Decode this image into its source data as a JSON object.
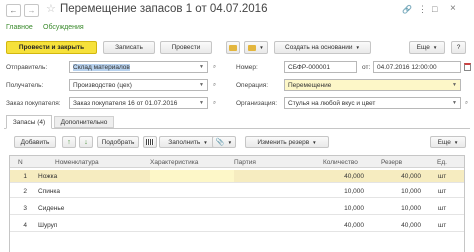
{
  "window": {
    "title": "Перемещение запасов 1 от 04.07.2016"
  },
  "tabs": {
    "main": "Главное",
    "discussions": "Обсуждения"
  },
  "toolbar": {
    "post_close": "Провести и закрыть",
    "save": "Записать",
    "post": "Провести",
    "create_based": "Создать на основании",
    "more": "Еще",
    "help": "?"
  },
  "form": {
    "sender_label": "Отправитель:",
    "sender_value": "Склад материалов",
    "receiver_label": "Получатель:",
    "receiver_value": "Производство (цех)",
    "buyer_order_label": "Заказ покупателя:",
    "buyer_order_value": "Заказ покупателя 16 от 01.07.2016",
    "number_label": "Номер:",
    "number_value": "СБФР-000001",
    "date_label": "от:",
    "date_value": "04.07.2016 12:00:00",
    "operation_label": "Операция:",
    "operation_value": "Перемещение",
    "org_label": "Организация:",
    "org_value": "Стулья на любой вкус и цвет"
  },
  "section_tabs": {
    "stocks": "Запасы (4)",
    "additional": "Дополнительно"
  },
  "table_toolbar": {
    "add": "Добавить",
    "pick": "Подобрать",
    "fill": "Заполнить",
    "change_reserve": "Изменить резерв",
    "more": "Еще"
  },
  "table": {
    "headers": {
      "n": "N",
      "item": "Номенклатура",
      "char": "Характеристика",
      "batch": "Партия",
      "qty": "Количество",
      "reserve": "Резерв",
      "unit": "Ед."
    },
    "rows": [
      {
        "n": "1",
        "item": "Ножка",
        "char": "",
        "batch": "",
        "qty": "40,000",
        "reserve": "40,000",
        "unit": "шт"
      },
      {
        "n": "2",
        "item": "Спинка",
        "char": "",
        "batch": "",
        "qty": "10,000",
        "reserve": "10,000",
        "unit": "шт"
      },
      {
        "n": "3",
        "item": "Сиденье",
        "char": "",
        "batch": "",
        "qty": "10,000",
        "reserve": "10,000",
        "unit": "шт"
      },
      {
        "n": "4",
        "item": "Шуруп",
        "char": "",
        "batch": "",
        "qty": "40,000",
        "reserve": "40,000",
        "unit": "шт"
      }
    ]
  },
  "colors": {
    "accent_yellow": "#f6e13b",
    "selected_row": "#f6ecc0",
    "link_green": "#3a8a2c"
  }
}
